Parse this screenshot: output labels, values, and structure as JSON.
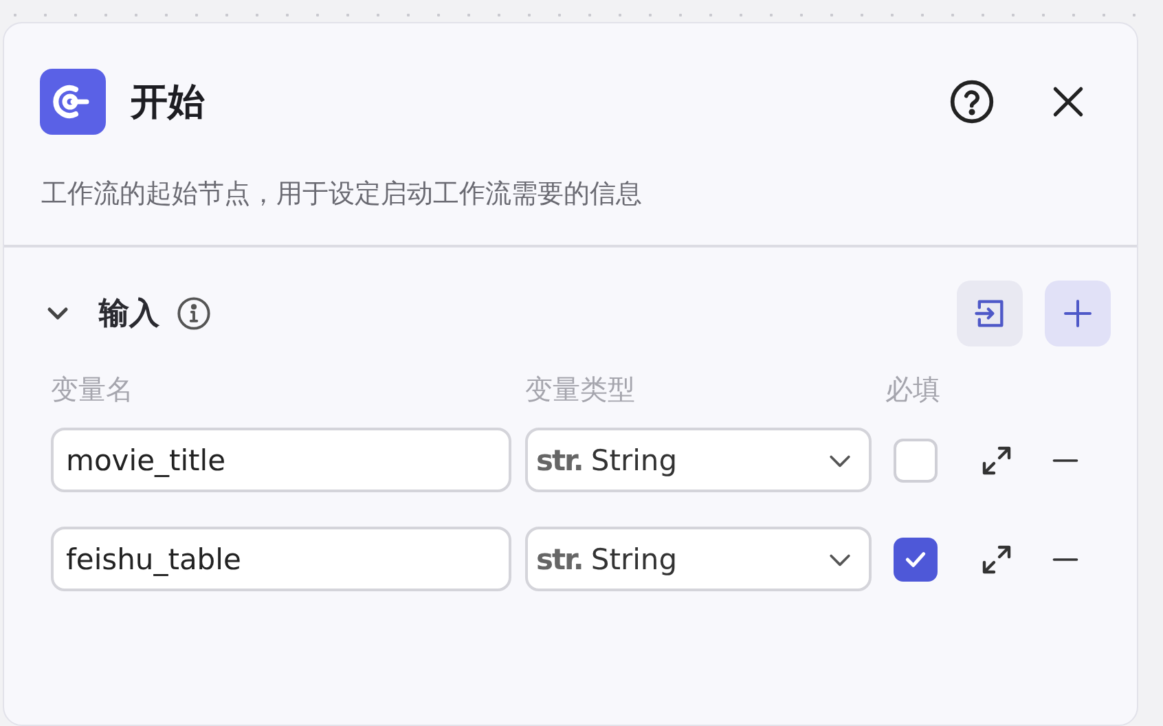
{
  "node": {
    "title": "开始",
    "description": "工作流的起始节点，用于设定启动工作流需要的信息"
  },
  "section": {
    "title": "输入",
    "expanded": true
  },
  "columns": [
    "变量名",
    "变量类型",
    "必填"
  ],
  "variables": [
    {
      "name": "movie_title",
      "type_prefix": "str.",
      "type": "String",
      "required": false
    },
    {
      "name": "feishu_table",
      "type_prefix": "str.",
      "type": "String",
      "required": true
    }
  ]
}
